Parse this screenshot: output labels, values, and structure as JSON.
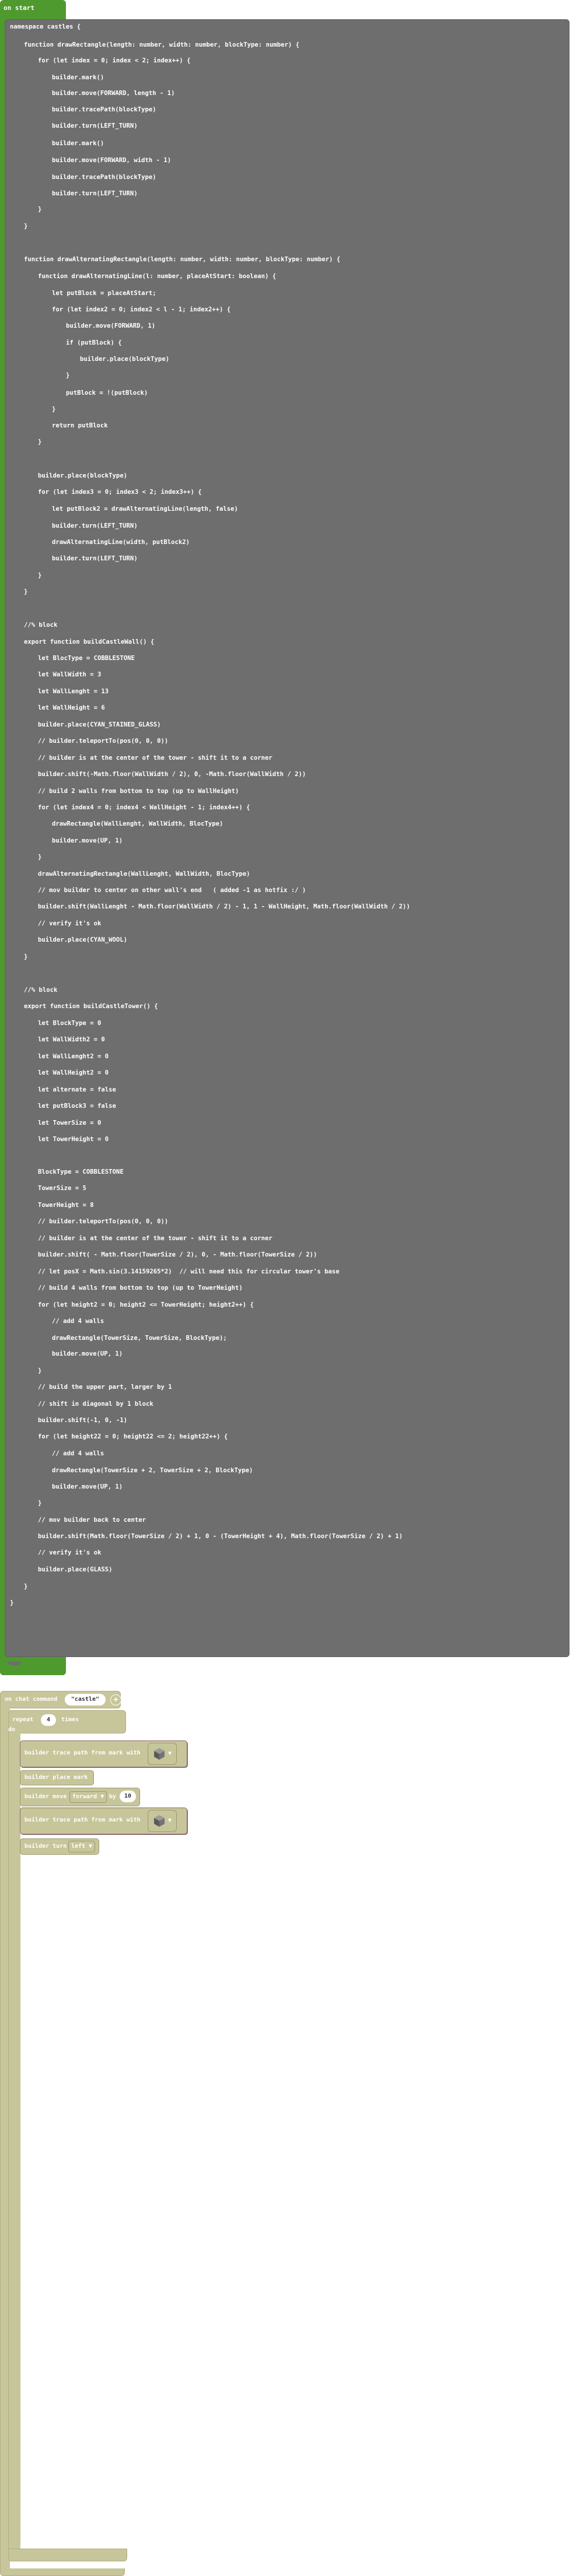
{
  "on_start": {
    "label": "on start"
  },
  "code_lines": [
    "namespace castles {",
    "function drawRectangle(length: number, width: number, blockType: number) {",
    "for (let index = 0; index < 2; index++) {",
    "builder.mark()",
    "builder.move(FORWARD, length - 1)",
    "builder.tracePath(blockType)",
    "builder.turn(LEFT_TURN)",
    "builder.mark()",
    "builder.move(FORWARD, width - 1)",
    "builder.tracePath(blockType)",
    "builder.turn(LEFT_TURN)",
    "}",
    "}",
    "function drawAlternatingRectangle(length: number, width: number, blockType: number) {",
    "function drawAlternatingLine(l: number, placeAtStart: boolean) {",
    "let putBlock = placeAtStart;",
    "for (let index2 = 0; index2 < l - 1; index2++) {",
    "builder.move(FORWARD, 1)",
    "if (putBlock) {",
    "builder.place(blockType)",
    "}",
    "putBlock = !(putBlock)",
    "}",
    "return putBlock",
    "}",
    "builder.place(blockType)",
    "for (let index3 = 0; index3 < 2; index3++) {",
    "let putBlock2 = drawAlternatingLine(length, false)",
    "builder.turn(LEFT_TURN)",
    "drawAlternatingLine(width, putBlock2)",
    "builder.turn(LEFT_TURN)",
    "}",
    "}",
    "//% block",
    "export function buildCastleWall() {",
    "let BlocType = COBBLESTONE",
    "let WallWidth = 3",
    "let WallLenght = 13",
    "let WallHeight = 6",
    "builder.place(CYAN_STAINED_GLASS)",
    "// builder.teleportTo(pos(0, 0, 0))",
    "// builder is at the center of the tower - shift it to a corner",
    "builder.shift(-Math.floor(WallWidth / 2), 0, -Math.floor(WallWidth / 2))",
    "// build 2 walls from bottom to top (up to WallHeight)",
    "for (let index4 = 0; index4 < WallHeight - 1; index4++) {",
    "drawRectangle(WallLenght, WallWidth, BlocType)",
    "builder.move(UP, 1)",
    "}",
    "drawAlternatingRectangle(WallLenght, WallWidth, BlocType)",
    "// mov builder to center on other wall's end   ( added -1 as hotfix :/ )",
    "builder.shift(WallLenght - Math.floor(WallWidth / 2) - 1, 1 - WallHeight, Math.floor(WallWidth / 2))",
    "// verify it's ok",
    "builder.place(CYAN_WOOL)",
    "}",
    "//% block",
    "export function buildCastleTower() {",
    "let BlockType = 0",
    "let WallWidth2 = 0",
    "let WallLenght2 = 0",
    "let WallHeight2 = 0",
    "let alternate = false",
    "let putBlock3 = false",
    "let TowerSize = 0",
    "let TowerHeight = 0",
    "BlockType = COBBLESTONE",
    "TowerSize = 5",
    "TowerHeight = 8",
    "// builder.teleportTo(pos(0, 0, 0))",
    "// builder is at the center of the tower - shift it to a corner",
    "builder.shift( - Math.floor(TowerSize / 2), 0, - Math.floor(TowerSize / 2))",
    "// let posX = Math.sin(3.14159265*2)  // will need this for circular tower's base",
    "// build 4 walls from bottom to top (up to TowerHeight)",
    "for (let height2 = 0; height2 <= TowerHeight; height2++) {",
    "// add 4 walls",
    "drawRectangle(TowerSize, TowerSize, BlockType);",
    "builder.move(UP, 1)",
    "}",
    "// build the upper part, larger by 1",
    "// shift in diagonal by 1 block",
    "builder.shift(-1, 0, -1)",
    "for (let height22 = 0; height22 <= 2; height22++) {",
    "// add 4 walls",
    "drawRectangle(TowerSize + 2, TowerSize + 2, BlockType)",
    "builder.move(UP, 1)",
    "}",
    "// mov builder back to center",
    "builder.shift(Math.floor(TowerSize / 2) + 1, 0 - (TowerHeight + 4), Math.floor(TowerSize / 2) + 1)",
    "// verify it's ok",
    "builder.place(GLASS)",
    "}",
    "}"
  ],
  "chat": {
    "label": "on chat command",
    "command": "\"castle\"",
    "plus": "+"
  },
  "repeat": {
    "label": "repeat",
    "count": "4",
    "times_label": "times",
    "do_label": "do"
  },
  "statements": [
    {
      "label": "builder trace path from mark with"
    },
    {
      "label": "builder place mark"
    },
    {
      "label": "builder move",
      "direction": "forward",
      "by_label": "by",
      "amount": "10"
    },
    {
      "label": "builder trace path from mark with"
    },
    {
      "label": "builder turn",
      "turn": "left"
    }
  ],
  "colors": {
    "on_start": "#4f9a2f",
    "code_block": "#6e6e6e",
    "builder_block": "#c7c59a"
  }
}
